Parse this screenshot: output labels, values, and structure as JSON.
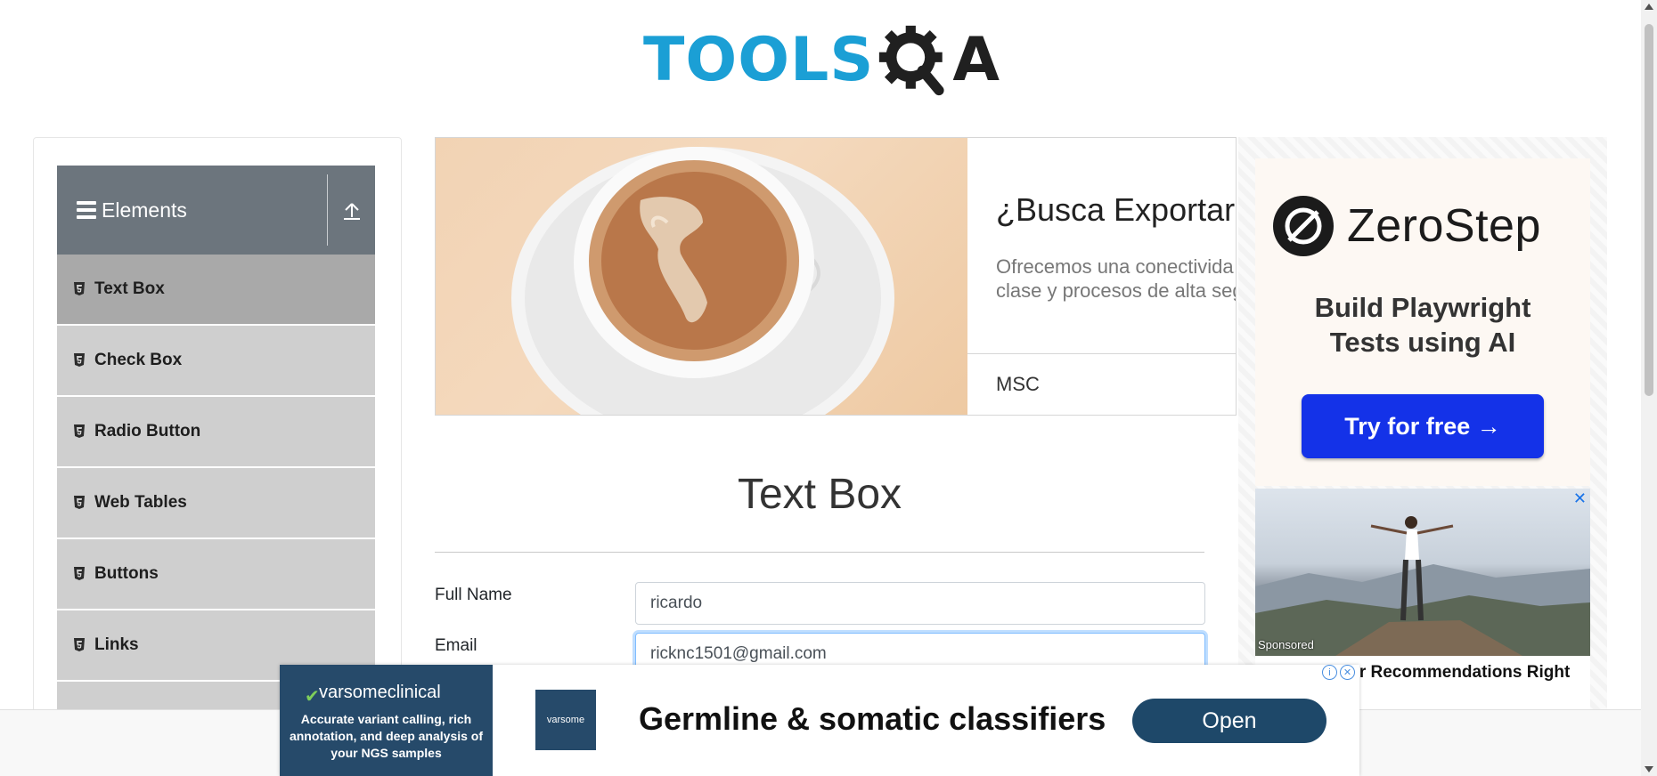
{
  "logo": {
    "text_part": "TOOLS",
    "suffix": "A",
    "alt": "TOOLSQA"
  },
  "sidebar": {
    "group_title": "Elements",
    "items": [
      {
        "label": "Text Box",
        "active": true
      },
      {
        "label": "Check Box"
      },
      {
        "label": "Radio Button"
      },
      {
        "label": "Web Tables"
      },
      {
        "label": "Buttons"
      },
      {
        "label": "Links"
      }
    ]
  },
  "banner": {
    "headline": "¿Busca Exportar",
    "body_line1": "Ofrecemos una conectivida",
    "body_line2": "clase y procesos de alta seg",
    "brand": "MSC"
  },
  "right_ad": {
    "brand": "ZeroStep",
    "tagline_line1": "Build Playwright",
    "tagline_line2": "Tests using AI",
    "cta": "Try for free →",
    "sponsored_label": "Sponsored",
    "close": "✕",
    "sponsored_title": "Nine Tips Our Recommendations Right for You"
  },
  "main": {
    "title": "Text Box",
    "fields": {
      "full_name_label": "Full Name",
      "full_name_value": "ricardo",
      "email_label": "Email",
      "email_value": "ricknc1501@gmail.com"
    }
  },
  "bottom_ad": {
    "brand": "varsomeclinical",
    "description": "Accurate variant calling, rich annotation, and deep analysis of your NGS samples",
    "mini_logo": "varsome",
    "headline": "Germline & somatic classifiers",
    "cta": "Open"
  },
  "colors": {
    "logo_blue": "#1b9fd5",
    "sidebar_header": "#6c757d",
    "sidebar_item": "#cfcfcf",
    "sidebar_active": "#a9a9a9",
    "zerostep_button": "#1432e8",
    "varsome_navy": "#1e4869"
  }
}
